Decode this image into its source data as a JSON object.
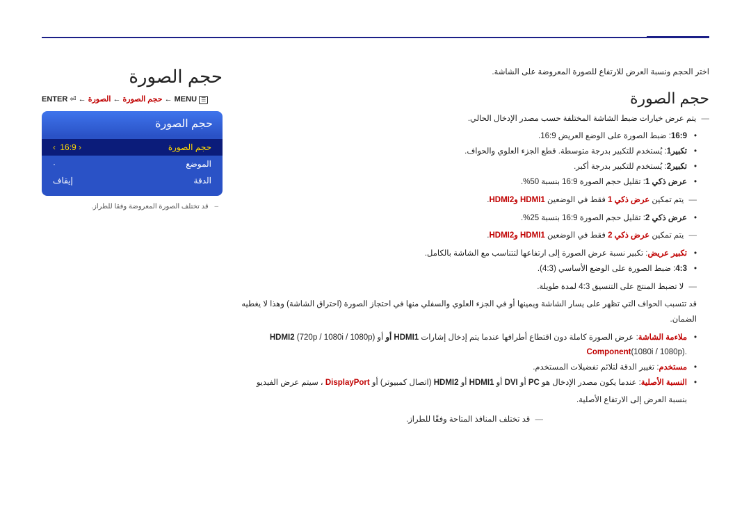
{
  "page_title": "حجم الصورة",
  "menu_path": {
    "enter": "ENTER",
    "enter_sym": "⏎",
    "arrow": "←",
    "bc_size": "حجم الصورة",
    "bc_pic": "الصورة",
    "menu": "MENU",
    "menu_sym": "☰"
  },
  "osd": {
    "title": "حجم الصورة",
    "rows": [
      {
        "label": "حجم الصورة",
        "value": "16:9",
        "selected": true
      },
      {
        "label": "الموضع",
        "value": "·",
        "selected": false
      },
      {
        "label": "الدقة",
        "value": "إيقاف",
        "selected": false
      }
    ],
    "note_prefix": "–",
    "note": "قد تختلف الصورة المعروضة وفقا للطراز."
  },
  "intro": "اختر الحجم ونسبة العرض للارتفاع للصورة المعروضة على الشاشة.",
  "section_title": "حجم الصورة",
  "preface": "يتم عرض خيارات ضبط الشاشة المختلفة حسب مصدر الإدخال الحالي.",
  "bullets": [
    {
      "key": "16:9",
      "text": ": ضبط الصورة على الوضع العريض 16:9."
    },
    {
      "key": "تكبير1",
      "text": ": يُستخدم للتكبير بدرجة متوسطة. قطع الجزء العلوي والحواف."
    },
    {
      "key": "تكبير2",
      "text": ": يُستخدم للتكبير بدرجة أكبر."
    },
    {
      "key": "عرض ذكي 1",
      "text": ": تقليل حجم الصورة 16:9 بنسبة 50%."
    },
    {
      "sub": true,
      "text_pre": "يتم تمكين ",
      "key_red": "عرض ذكي 1",
      "text_mid": " فقط في الوضعين ",
      "tail_red": "HDMI1 وHDMI2",
      "tail": "."
    },
    {
      "key": "عرض ذكي 2",
      "text": ": تقليل حجم الصورة 16:9 بنسبة 25%."
    },
    {
      "sub": true,
      "text_pre": "يتم تمكين ",
      "key_red": "عرض ذكي 2",
      "text_mid": " فقط في الوضعين ",
      "tail_red": "HDMI1 وHDMI2",
      "tail": "."
    },
    {
      "key": "تكبير عريض",
      "text": ": تكبير نسبة عرض الصورة إلى ارتفاعها لتتناسب مع الشاشة بالكامل."
    },
    {
      "key": "4:3",
      "text": ": ضبط الصورة على الوضع الأساسي (4:3)."
    }
  ],
  "warn_line": "لا تضبط المنتج على التنسيق 4:3 لمدة طويلة.",
  "warn_para": "قد تتسبب الحواف التي تظهر على يسار الشاشة ويمينها أو في الجزء العلوي والسفلي منها في احتجاز الصورة (احتراق الشاشة) وهذا لا يغطيه الضمان.",
  "screen_fit_key": "ملاءمة الشاشة",
  "screen_fit_text": ": عرض الصورة كاملة دون اقتطاع أطرافها عندما يتم إدخال إشارات ",
  "screen_fit_hdmi": "HDMI1 أو HDMI2",
  "screen_fit_res": " (720p / 1080i / 1080p) أو ",
  "screen_fit_comp": "Component",
  "screen_fit_tail": "(1080i / 1080p).",
  "custom_key": "مستخدم",
  "custom_text": ": تغيير الدقة لتلائم تفضيلات المستخدم.",
  "orig_key": "النسبة الأصلية",
  "orig_text_a": ": عندما يكون مصدر الإدخال هو ",
  "orig_pc": "PC",
  "orig_or1": " أو ",
  "orig_dvi": "DVI",
  "orig_or2": " أو ",
  "orig_h1": "HDMI1",
  "orig_or3": " أو ",
  "orig_h2": "HDMI2",
  "orig_paren": " (اتصال كمبيوتر) أو ",
  "orig_dp": "DisplayPort",
  "orig_tail": " ، سيتم عرض الفيديو",
  "orig_line2": "بنسبة العرض إلى الارتفاع الأصلية.",
  "foot_note": "قد تختلف المنافذ المتاحة وفقًا للطراز."
}
